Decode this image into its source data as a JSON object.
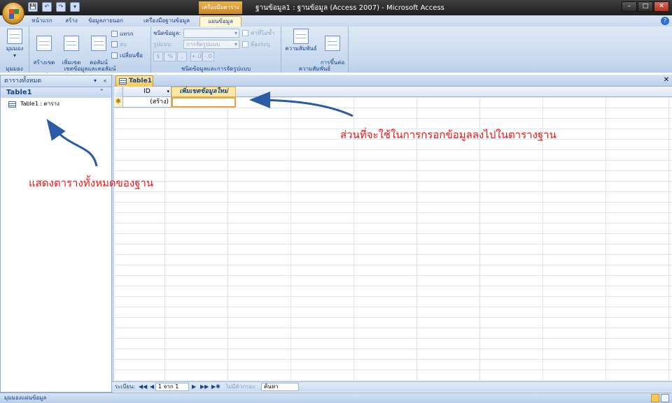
{
  "window": {
    "title": "ฐานข้อมูล1 : ฐานข้อมูล (Access 2007) - Microsoft Access",
    "context_tab_header": "เครื่องมือตาราง",
    "controls": {
      "minimize": "–",
      "maximize": "□",
      "close": "✕"
    }
  },
  "quick_access": {
    "save": "💾",
    "undo": "↶",
    "redo": "↷",
    "customize": "▾"
  },
  "ribbon_tabs": [
    {
      "label": "หน้าแรก"
    },
    {
      "label": "สร้าง"
    },
    {
      "label": "ข้อมูลภายนอก"
    },
    {
      "label": "เครื่องมือฐานข้อมูล"
    },
    {
      "label": "แผ่นข้อมูล"
    }
  ],
  "help": "?",
  "ribbon": {
    "views": {
      "view_label": "มุมมอง",
      "view_dd": "▾",
      "group_label": "มุมมอง"
    },
    "fields_columns": {
      "new_field": "สร้างเขต\nข้อมูล",
      "add_existing": "เพิ่มเขต\nข้อมูลที่มีอยู่",
      "lookup_column": "คอลัมน์\nค้นหา",
      "insert": "แทรก",
      "delete": "ลบ",
      "rename": "เปลี่ยนชื่อ",
      "group_label": "เขตข้อมูลและคอลัมน์"
    },
    "data_type_formatting": {
      "data_type_label": "ชนิดข้อมูล:",
      "data_type_value": "",
      "format_label": "รูปแบบ:",
      "format_value": "การจัดรูปแบบ",
      "unique_label": "ค่าที่ไม่ซ้ำ",
      "required_label": "ต้องระบุ",
      "currency": "$",
      "percent": "%",
      "comma": ",",
      "inc_decimal": "+.0",
      "dec_decimal": "-.0",
      "group_label": "ชนิดข้อมูลและการจัดรูปแบบ"
    },
    "relationships": {
      "relationships": "ความสัมพันธ์",
      "object_dependencies": "การขึ้นต่อ\nกันของวัตถุ",
      "group_label": "ความสัมพันธ์"
    }
  },
  "nav_pane": {
    "header": "ตารางทั้งหมด",
    "dropdown": "▾",
    "collapse": "«",
    "group_title": "Table1",
    "group_chevron": "⌃",
    "items": [
      {
        "label": "Table1 : ตาราง"
      }
    ]
  },
  "document": {
    "tab_label": "Table1",
    "close": "✕",
    "columns": [
      {
        "label": "ID",
        "dropdown": "▾"
      },
      {
        "label": "เพิ่มเขตข้อมูลใหม่"
      }
    ],
    "new_row": {
      "marker": "✱",
      "id_value": "(สร้าง)",
      "new_value": ""
    }
  },
  "record_nav": {
    "label": "ระเบียน:",
    "first": "◀◀",
    "prev": "◀",
    "position": "1 จาก 1",
    "next": "▶",
    "last": "▶▶",
    "new": "▶✱",
    "filter": "ไม่มีตัวกรอง",
    "search_label": "ค้นหา"
  },
  "status_bar": {
    "text": "มุมมองแผ่นข้อมูล"
  },
  "annotations": {
    "nav_note": "แสดงตารางทั้งหมดของฐาน",
    "grid_note": "ส่วนที่จะใช้ในการกรอกข้อมูลลงไปในตารางฐาน",
    "color": "#ee1515"
  }
}
